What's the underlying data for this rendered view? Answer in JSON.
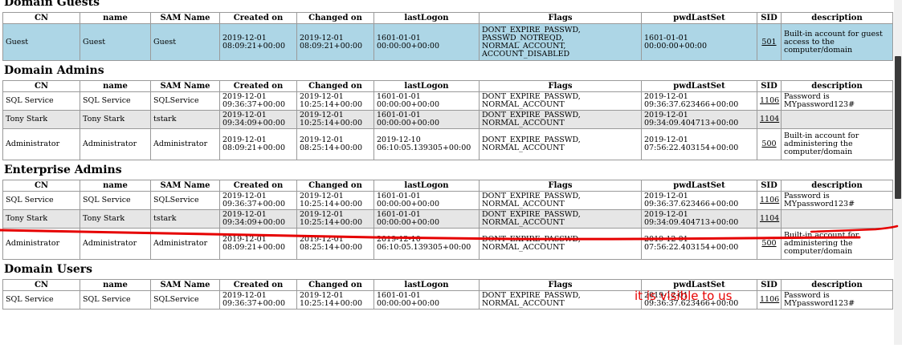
{
  "columns": [
    "CN",
    "name",
    "SAM Name",
    "Created on",
    "Changed on",
    "lastLogon",
    "Flags",
    "pwdLastSet",
    "SID",
    "description"
  ],
  "groups": [
    {
      "title": "Domain Guests",
      "rows": [
        {
          "cn": "Guest",
          "name": "Guest",
          "sam": "Guest",
          "created": "2019-12-01\n08:09:21+00:00",
          "changed": "2019-12-01\n08:09:21+00:00",
          "lastlogon": "1601-01-01\n00:00:00+00:00",
          "flags": "DONT_EXPIRE_PASSWD,\nPASSWD_NOTREQD,\nNORMAL_ACCOUNT,\nACCOUNT_DISABLED",
          "pwdlastset": "1601-01-01\n00:00:00+00:00",
          "sid": "501",
          "description": "Built-in account for guest access to the computer/domain"
        }
      ]
    },
    {
      "title": "Domain Admins",
      "rows": [
        {
          "cn": "SQL Service",
          "name": "SQL Service",
          "sam": "SQLService",
          "created": "2019-12-01\n09:36:37+00:00",
          "changed": "2019-12-01\n10:25:14+00:00",
          "lastlogon": "1601-01-01\n00:00:00+00:00",
          "flags": "DONT_EXPIRE_PASSWD,\nNORMAL_ACCOUNT",
          "pwdlastset": "2019-12-01\n09:36:37.623466+00:00",
          "sid": "1106",
          "description": "Password is MYpassword123#"
        },
        {
          "cn": "Tony Stark",
          "name": "Tony Stark",
          "sam": "tstark",
          "created": "2019-12-01\n09:34:09+00:00",
          "changed": "2019-12-01\n10:25:14+00:00",
          "lastlogon": "1601-01-01\n00:00:00+00:00",
          "flags": "DONT_EXPIRE_PASSWD,\nNORMAL_ACCOUNT",
          "pwdlastset": "2019-12-01\n09:34:09.404713+00:00",
          "sid": "1104",
          "description": ""
        },
        {
          "cn": "Administrator",
          "name": "Administrator",
          "sam": "Administrator",
          "created": "2019-12-01\n08:09:21+00:00",
          "changed": "2019-12-01\n08:25:14+00:00",
          "lastlogon": "2019-12-10\n06:10:05.139305+00:00",
          "flags": "DONT_EXPIRE_PASSWD,\nNORMAL_ACCOUNT",
          "pwdlastset": "2019-12-01\n07:56:22.403154+00:00",
          "sid": "500",
          "description": "Built-in account for administering the computer/domain"
        }
      ]
    },
    {
      "title": "Enterprise Admins",
      "rows": [
        {
          "cn": "SQL Service",
          "name": "SQL Service",
          "sam": "SQLService",
          "created": "2019-12-01\n09:36:37+00:00",
          "changed": "2019-12-01\n10:25:14+00:00",
          "lastlogon": "1601-01-01\n00:00:00+00:00",
          "flags": "DONT_EXPIRE_PASSWD,\nNORMAL_ACCOUNT",
          "pwdlastset": "2019-12-01\n09:36:37.623466+00:00",
          "sid": "1106",
          "description": "Password is MYpassword123#"
        },
        {
          "cn": "Tony Stark",
          "name": "Tony Stark",
          "sam": "tstark",
          "created": "2019-12-01\n09:34:09+00:00",
          "changed": "2019-12-01\n10:25:14+00:00",
          "lastlogon": "1601-01-01\n00:00:00+00:00",
          "flags": "DONT_EXPIRE_PASSWD,\nNORMAL_ACCOUNT",
          "pwdlastset": "2019-12-01\n09:34:09.404713+00:00",
          "sid": "1104",
          "description": ""
        },
        {
          "cn": "Administrator",
          "name": "Administrator",
          "sam": "Administrator",
          "created": "2019-12-01\n08:09:21+00:00",
          "changed": "2019-12-01\n08:25:14+00:00",
          "lastlogon": "2019-12-10\n06:10:05.139305+00:00",
          "flags": "DONT_EXPIRE_PASSWD,\nNORMAL_ACCOUNT",
          "pwdlastset": "2019-12-01\n07:56:22.403154+00:00",
          "sid": "500",
          "description": "Built-in account for administering the computer/domain"
        }
      ]
    },
    {
      "title": "Domain Users",
      "rows": [
        {
          "cn": "SQL Service",
          "name": "SQL Service",
          "sam": "SQLService",
          "created": "2019-12-01\n09:36:37+00:00",
          "changed": "2019-12-01\n10:25:14+00:00",
          "lastlogon": "1601-01-01\n00:00:00+00:00",
          "flags": "DONT_EXPIRE_PASSWD,\nNORMAL_ACCOUNT",
          "pwdlastset": "2019-12-01\n09:36:37.623466+00:00",
          "sid": "1106",
          "description": "Password is MYpassword123#"
        }
      ]
    }
  ],
  "annotation": {
    "text": "it is visible to us",
    "color": "#e60000"
  },
  "colors": {
    "row_selected": "#add6e6",
    "row_shaded": "#e6e6e6",
    "border": "#9a9a9a"
  }
}
